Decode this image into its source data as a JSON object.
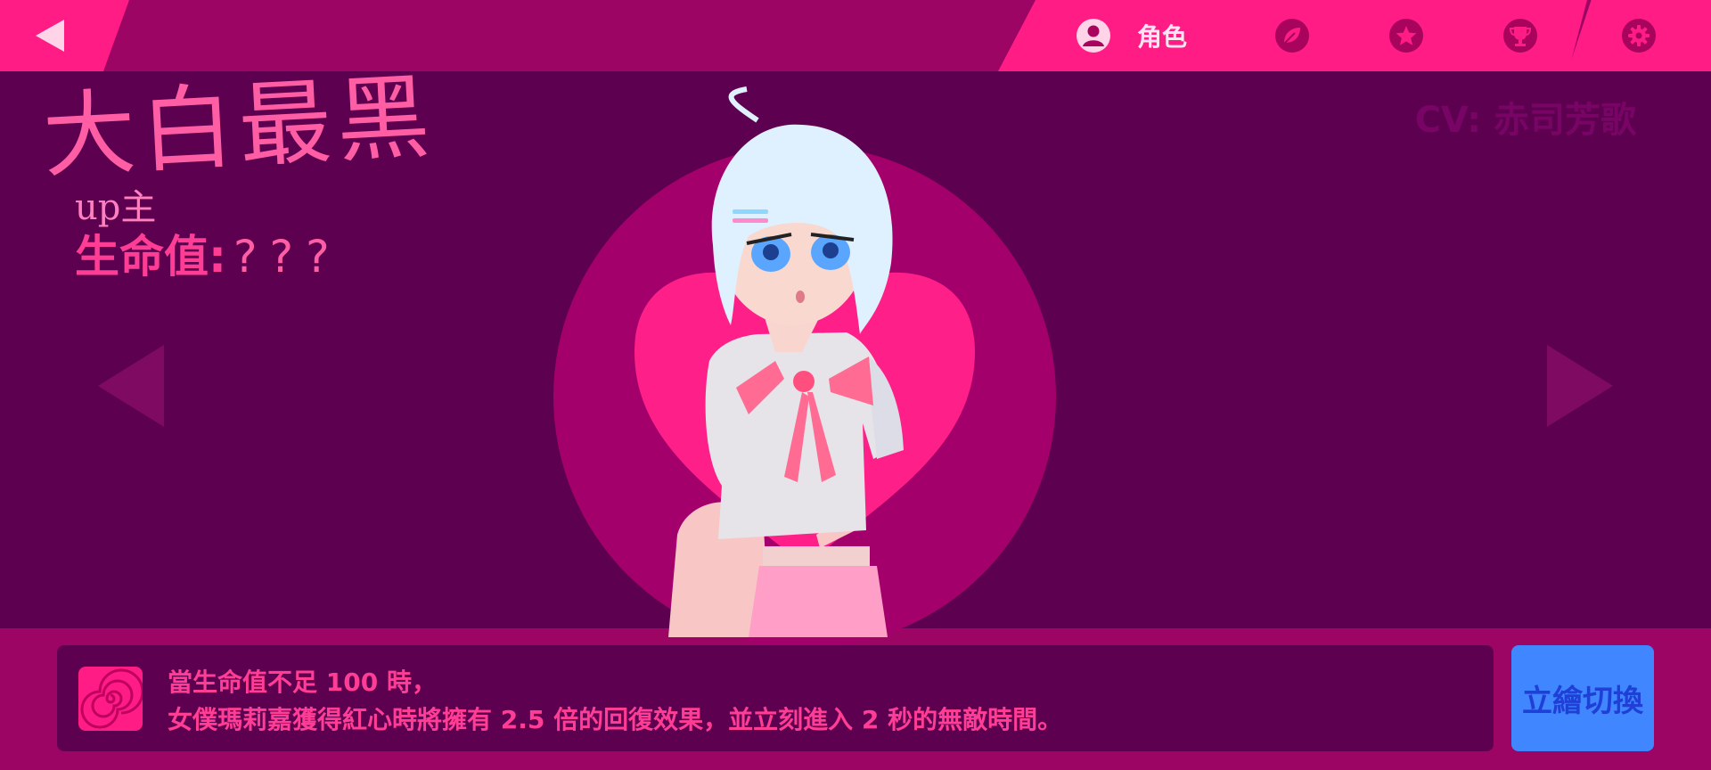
{
  "colors": {
    "background": "#5e0050",
    "bar": "#9c0564",
    "accent_pink": "#ff1c85",
    "text_pink": "#ff3d95",
    "button_blue": "#3f86ff"
  },
  "nav": {
    "back_icon": "back-triangle-icon",
    "tabs": [
      {
        "icon": "person-icon",
        "label": "角色",
        "active": true
      },
      {
        "icon": "leaf-icon",
        "label": ""
      },
      {
        "icon": "star-icon",
        "label": ""
      },
      {
        "icon": "trophy-icon",
        "label": ""
      },
      {
        "icon": "gear-icon",
        "label": ""
      }
    ]
  },
  "character": {
    "name": "大白最黑",
    "role": "up主",
    "hp_label": "生命值:",
    "hp_value": "???",
    "cv": "CV: 赤司芳歌"
  },
  "skill": {
    "icon": "spiral-icon",
    "line1": "當生命值不足 100 時，",
    "line2": "女僕瑪莉嘉獲得紅心時將擁有 2.5 倍的回復效果，並立刻進入 2 秒的無敵時間。"
  },
  "buttons": {
    "switch_label": "立繪切換",
    "prev_icon": "left-arrow-icon",
    "next_icon": "right-arrow-icon"
  }
}
